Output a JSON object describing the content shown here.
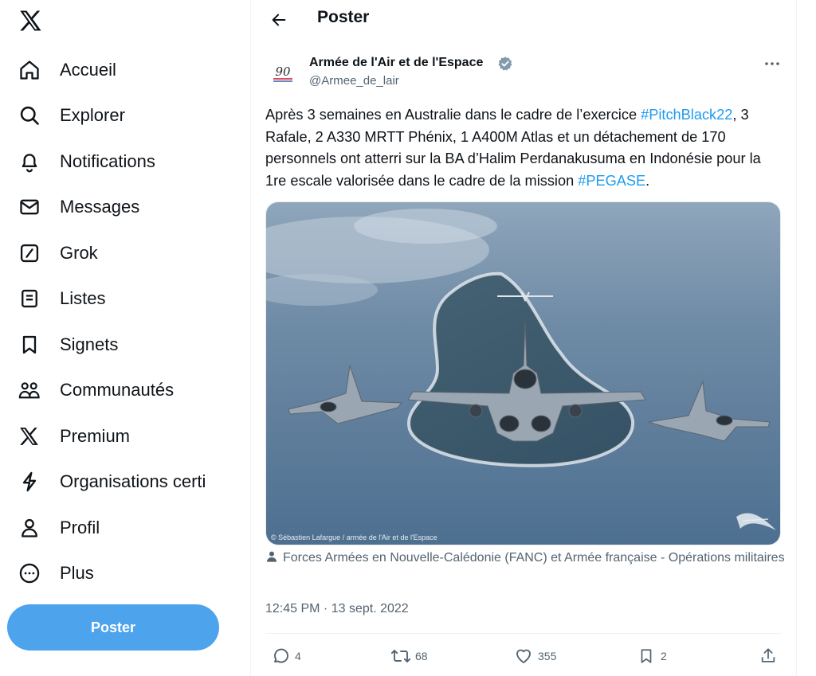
{
  "nav": {
    "items": [
      {
        "label": "Accueil",
        "icon": "home-icon"
      },
      {
        "label": "Explorer",
        "icon": "search-icon"
      },
      {
        "label": "Notifications",
        "icon": "bell-icon"
      },
      {
        "label": "Messages",
        "icon": "envelope-icon"
      },
      {
        "label": "Grok",
        "icon": "grok-icon"
      },
      {
        "label": "Listes",
        "icon": "list-icon"
      },
      {
        "label": "Signets",
        "icon": "bookmark-icon"
      },
      {
        "label": "Communautés",
        "icon": "communities-icon"
      },
      {
        "label": "Premium",
        "icon": "x-logo-icon"
      },
      {
        "label": "Organisations certi",
        "icon": "lightning-icon"
      },
      {
        "label": "Profil",
        "icon": "person-icon"
      },
      {
        "label": "Plus",
        "icon": "more-circle-icon"
      }
    ],
    "post_button": "Poster"
  },
  "header": {
    "title": "Poster"
  },
  "tweet": {
    "author_name": "Armée de l'Air et de l'Espace",
    "author_handle": "@Armee_de_lair",
    "avatar_text": "90",
    "text_1": "Après 3 semaines en Australie dans le cadre de l’exercice ",
    "hashtag_1": "#PitchBlack22",
    "text_2": ", 3 Rafale, 2 A330 MRTT Phénix, 1 A400M Atlas et un détachement de 170 personnels ont atterri sur la BA d’Halim Perdanakusuma en Indonésie pour la 1re escale valorisée dans le cadre de la mission ",
    "hashtag_2": "#PEGASE",
    "text_3": ".",
    "photo_credit": "© Sébastien Lafargue / armée de l'Air et de l'Espace",
    "tagged": "Forces Armées en Nouvelle-Calédonie (FANC) et Armée française - Opérations militaires",
    "timestamp": "12:45 PM · 13 sept. 2022"
  },
  "actions": {
    "replies": "4",
    "reposts": "68",
    "likes": "355",
    "bookmarks": "2"
  },
  "colors": {
    "accent": "#1d9bf0",
    "post_button": "#4da3ec",
    "muted": "#536471",
    "verified": "#829aab"
  }
}
